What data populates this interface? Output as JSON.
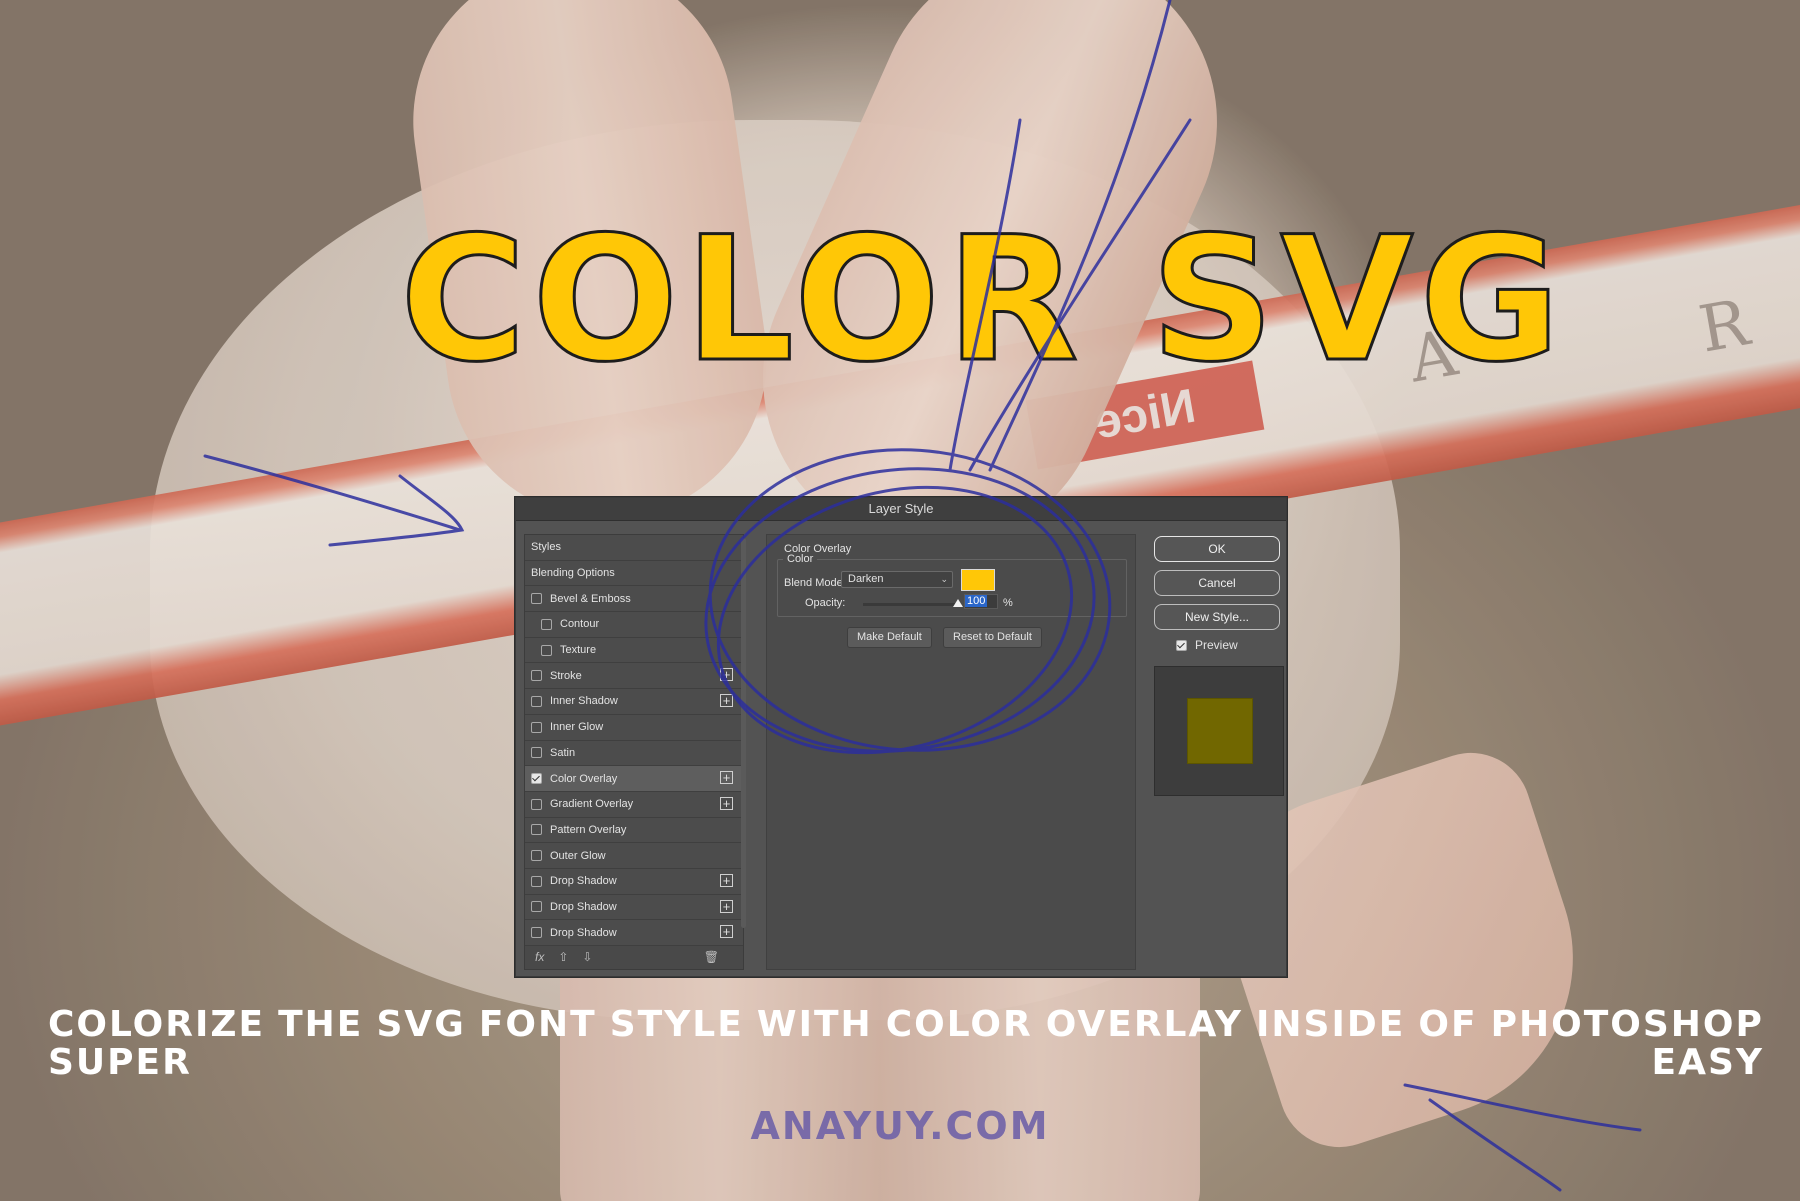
{
  "banner": {
    "title": "COLOR SVG",
    "caption_words_line1": [
      "COLORIZE",
      "THE",
      "SVG",
      "FONT",
      "STYLE",
      "WITH",
      "COLOR",
      "OVERLAY",
      "INSIDE",
      "OF",
      "PHOTOSHOP"
    ],
    "caption_line2_left": "SUPER",
    "caption_line2_right": "EASY",
    "watermark": "ANAYUY.COM",
    "pole_label": "Nice",
    "title_color": "#ffc706",
    "scribble_color": "#2c2f9e"
  },
  "dialog": {
    "title": "Layer Style",
    "styles_header": "Styles",
    "blending_options": "Blending Options",
    "items": [
      {
        "label": "Bevel & Emboss",
        "checked": false,
        "plus": false,
        "sub": false
      },
      {
        "label": "Contour",
        "checked": false,
        "plus": false,
        "sub": true
      },
      {
        "label": "Texture",
        "checked": false,
        "plus": false,
        "sub": true
      },
      {
        "label": "Stroke",
        "checked": false,
        "plus": true,
        "sub": false
      },
      {
        "label": "Inner Shadow",
        "checked": false,
        "plus": true,
        "sub": false
      },
      {
        "label": "Inner Glow",
        "checked": false,
        "plus": false,
        "sub": false
      },
      {
        "label": "Satin",
        "checked": false,
        "plus": false,
        "sub": false
      },
      {
        "label": "Color Overlay",
        "checked": true,
        "plus": true,
        "sub": false
      },
      {
        "label": "Gradient Overlay",
        "checked": false,
        "plus": true,
        "sub": false
      },
      {
        "label": "Pattern Overlay",
        "checked": false,
        "plus": false,
        "sub": false
      },
      {
        "label": "Outer Glow",
        "checked": false,
        "plus": false,
        "sub": false
      },
      {
        "label": "Drop Shadow",
        "checked": false,
        "plus": true,
        "sub": false
      },
      {
        "label": "Drop Shadow",
        "checked": false,
        "plus": true,
        "sub": false
      },
      {
        "label": "Drop Shadow",
        "checked": false,
        "plus": true,
        "sub": false
      }
    ],
    "footer_icons": [
      "fx-icon",
      "arrow-up-icon",
      "arrow-down-icon",
      "trash-icon"
    ],
    "fx_label": "fx",
    "panel": {
      "section_title": "Color Overlay",
      "group_title": "Color",
      "blend_mode_label": "Blend Mode:",
      "blend_mode_value": "Darken",
      "overlay_color": "#ffc707",
      "opacity_label": "Opacity:",
      "opacity_value": "100",
      "opacity_unit": "%",
      "make_default": "Make Default",
      "reset_default": "Reset to Default"
    },
    "buttons": {
      "ok": "OK",
      "cancel": "Cancel",
      "new_style": "New Style..."
    },
    "preview_label": "Preview",
    "preview_checked": true,
    "preview_color": "#716700"
  }
}
